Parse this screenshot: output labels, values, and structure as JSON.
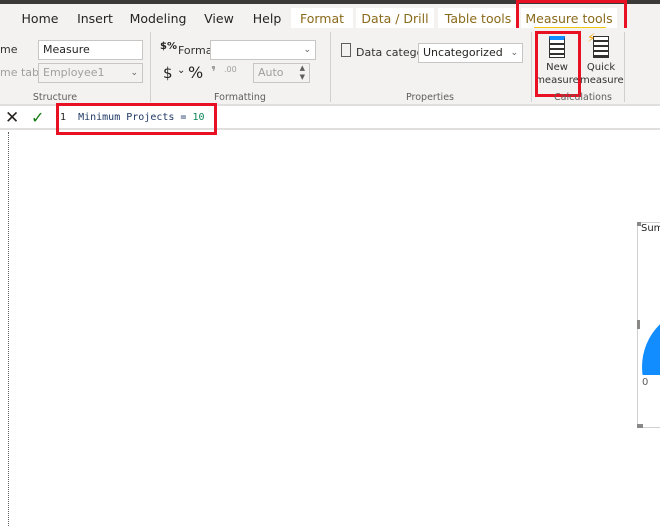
{
  "tabs": [
    {
      "label": "Home"
    },
    {
      "label": "Insert"
    },
    {
      "label": "Modeling"
    },
    {
      "label": "View"
    },
    {
      "label": "Help"
    },
    {
      "label": "Format"
    },
    {
      "label": "Data / Drill"
    },
    {
      "label": "Table tools"
    },
    {
      "label": "Measure tools",
      "active": true
    }
  ],
  "structure": {
    "name_label": "me",
    "name_value": "Measure",
    "home_table_label": "me table",
    "home_table_value": "Employee1",
    "group": "Structure"
  },
  "formatting": {
    "format_label": "Format",
    "format_value": "",
    "currency": "$",
    "percent": "%",
    "comma": "❜",
    "decimals": ".00",
    "auto": "Auto",
    "group": "Formatting"
  },
  "properties": {
    "data_category_label": "Data category",
    "data_category_value": "Uncategorized",
    "group": "Properties"
  },
  "calculations": {
    "new_measure": [
      "New",
      "measure"
    ],
    "quick_measure": [
      "Quick",
      "measure"
    ],
    "group": "Calculations"
  },
  "formula": {
    "line": "1",
    "text_name": "Minimum Projects = ",
    "text_value": "10"
  },
  "visual": {
    "title": "Sum",
    "min_label": "0",
    "gauge_color": "#118dff"
  },
  "colors": {
    "highlight": "#e81123",
    "accent_underline": "#f2c811",
    "context_tab": "#8a6a1a"
  }
}
